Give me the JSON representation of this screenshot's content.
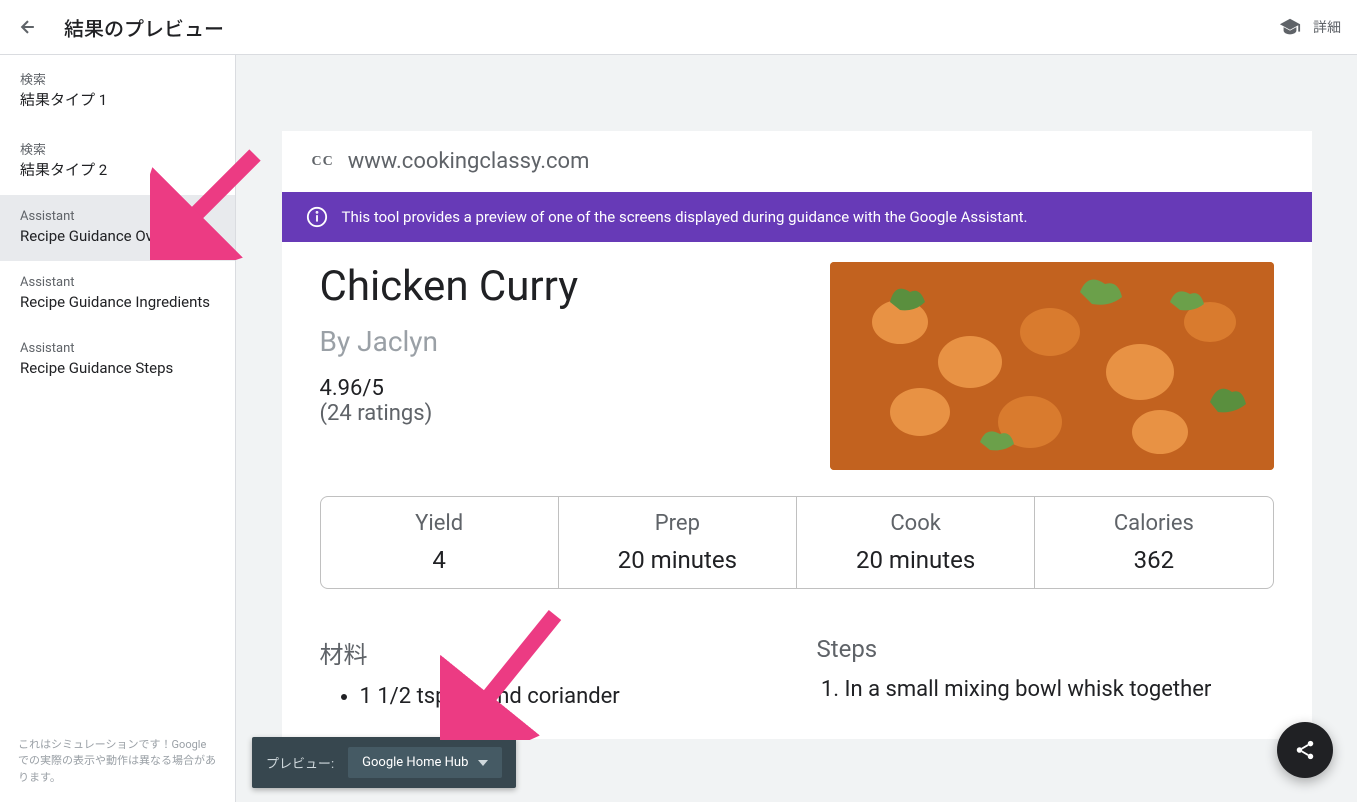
{
  "header": {
    "title": "結果のプレビュー",
    "details_label": "詳細"
  },
  "sidebar": {
    "items": [
      {
        "category": "検索",
        "label": "結果タイプ 1"
      },
      {
        "category": "検索",
        "label": "結果タイプ 2"
      },
      {
        "category": "Assistant",
        "label": "Recipe Guidance Overview"
      },
      {
        "category": "Assistant",
        "label": "Recipe Guidance Ingredients"
      },
      {
        "category": "Assistant",
        "label": "Recipe Guidance Steps"
      }
    ],
    "footer": "これはシミュレーションです！Google での実際の表示や動作は異なる場合があります。"
  },
  "preview": {
    "source_favicon": "CC",
    "source_url": "www.cookingclassy.com",
    "banner_text": "This tool provides a preview of one of the screens displayed during guidance with the Google Assistant.",
    "recipe": {
      "title": "Chicken Curry",
      "author_prefix": "By ",
      "author": "Jaclyn",
      "rating": "4.96/5",
      "ratings_count": "(24 ratings)",
      "stats": [
        {
          "label": "Yield",
          "value": "4"
        },
        {
          "label": "Prep",
          "value": "20 minutes"
        },
        {
          "label": "Cook",
          "value": "20 minutes"
        },
        {
          "label": "Calories",
          "value": "362"
        }
      ],
      "ingredients_title": "材料",
      "ingredients": [
        "1 1/2 tsp ground coriander"
      ],
      "steps_title": "Steps",
      "steps": [
        "In a small mixing bowl whisk together"
      ]
    }
  },
  "bottom_bar": {
    "label": "プレビュー:",
    "selected": "Google Home Hub"
  }
}
